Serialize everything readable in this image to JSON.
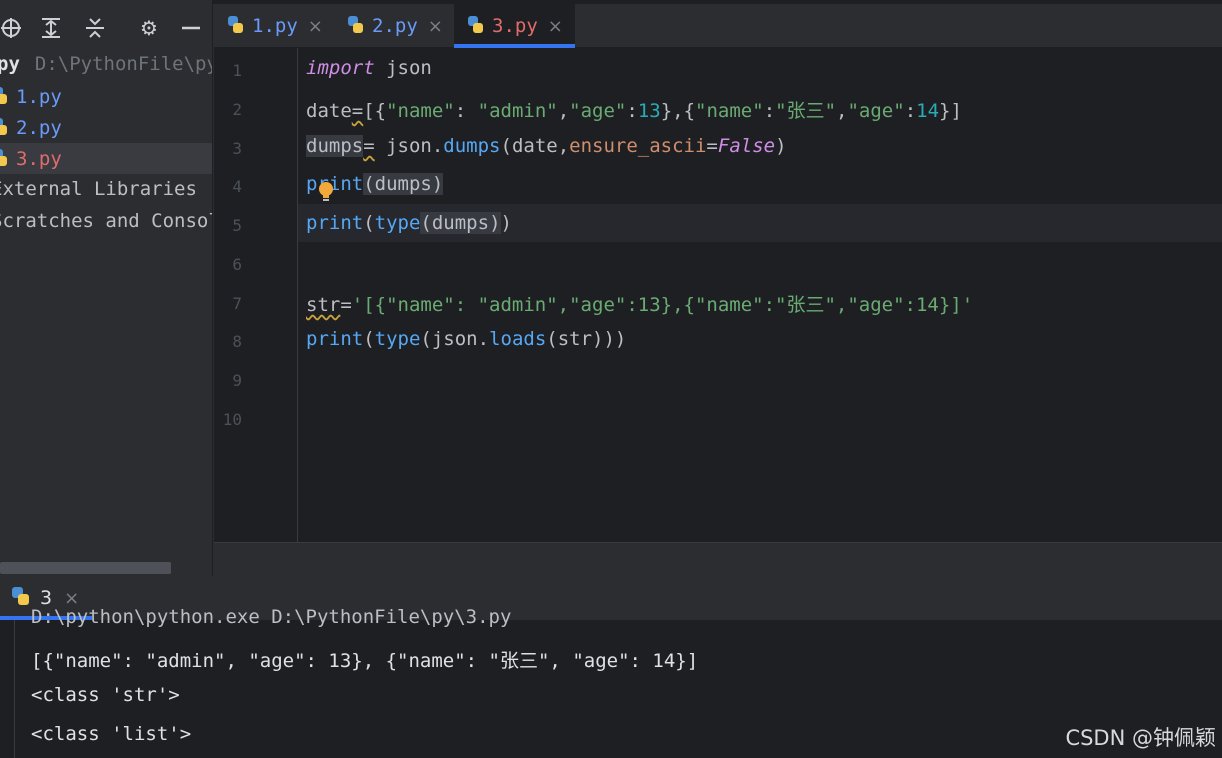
{
  "project": {
    "root_name": "py",
    "root_path": "D:\\PythonFile\\py",
    "files": [
      "1.py",
      "2.py",
      "3.py"
    ],
    "external_libraries": "External Libraries",
    "scratches": "Scratches and Consoles"
  },
  "tabs": [
    {
      "label": "1.py",
      "close": "×"
    },
    {
      "label": "2.py",
      "close": "×"
    },
    {
      "label": "3.py",
      "close": "×"
    }
  ],
  "editor": {
    "line_numbers": [
      "1",
      "2",
      "3",
      "4",
      "5",
      "6",
      "7",
      "8",
      "9",
      "10"
    ],
    "lines": {
      "l1_kw": "import",
      "l1_rest": " json",
      "l2_a": "date",
      "l2_b": "=",
      "l2_c": "[{",
      "l2_s1": "\"name\"",
      "l2_c2": ": ",
      "l2_s2": "\"admin\"",
      "l2_c3": ",",
      "l2_s3": "\"age\"",
      "l2_c4": ":",
      "l2_n1": "13",
      "l2_c5": "},{",
      "l2_s4": "\"name\"",
      "l2_c6": ":",
      "l2_s5": "\"张三\"",
      "l2_c7": ",",
      "l2_s6": "\"age\"",
      "l2_c8": ":",
      "l2_n2": "14",
      "l2_c9": "}]",
      "l3_a": "dumps",
      "l3_b": "=",
      "l3_c": " json.",
      "l3_fn": "dumps",
      "l3_d": "(date,",
      "l3_param": "ensure_ascii",
      "l3_e": "=",
      "l3_const": "False",
      "l3_f": ")",
      "l4_fn": "print",
      "l4_rest": "(dumps)",
      "l5_fn": "print",
      "l5_b": "(",
      "l5_fn2": "type",
      "l5_c": "(dumps",
      "l5_d": ")",
      "l5_e": ")",
      "l7_a": "str",
      "l7_b": "=",
      "l7_s": "'[{\"name\": \"admin\",\"age\":13},{\"name\":\"张三\",\"age\":14}]'",
      "l8_fn": "print",
      "l8_b": "(",
      "l8_fn2": "type",
      "l8_c": "(json.",
      "l8_fn3": "loads",
      "l8_d": "(str)))"
    }
  },
  "run": {
    "tab_label": "3",
    "tab_close": "×",
    "command": "D:\\python\\python.exe D:\\PythonFile\\py\\3.py",
    "output": [
      "[{\"name\": \"admin\", \"age\": 13}, {\"name\": \"张三\", \"age\": 14}]",
      "<class 'str'>",
      "<class 'list'>"
    ]
  },
  "watermark": "CSDN @钟佩颖",
  "colors": {
    "accent": "#3574f0",
    "active_tab_text": "#e06c6c",
    "file_text": "#6b9bfa"
  }
}
